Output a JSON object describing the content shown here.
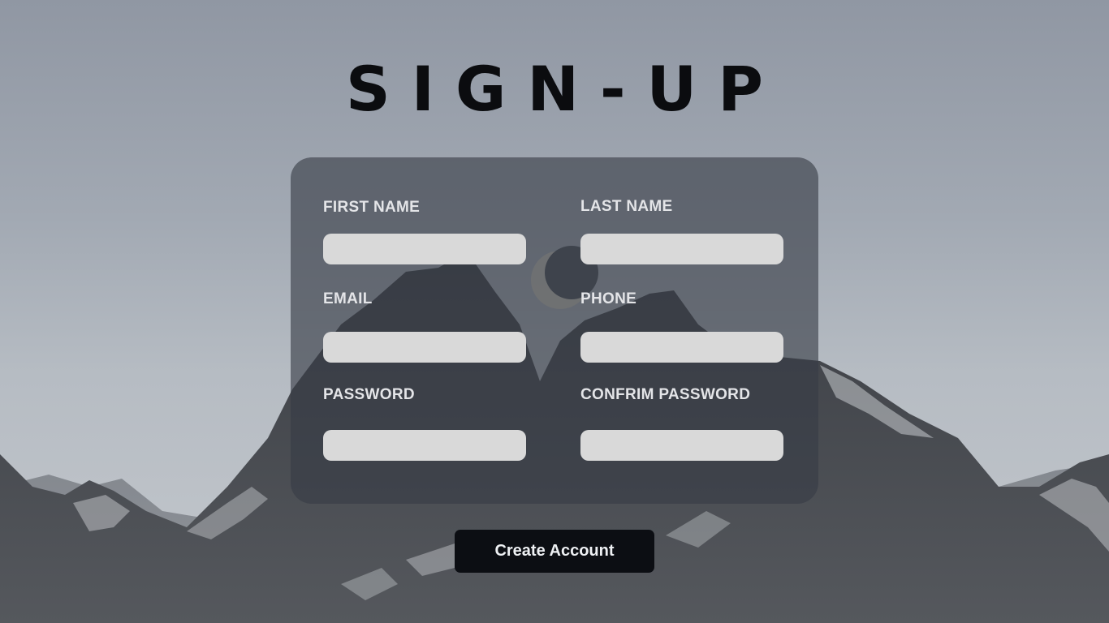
{
  "page": {
    "title": "SIGN-UP"
  },
  "form": {
    "first_name": {
      "label": "FIRST NAME",
      "value": ""
    },
    "last_name": {
      "label": "LAST NAME",
      "value": ""
    },
    "email": {
      "label": "EMAIL",
      "value": ""
    },
    "phone": {
      "label": "PHONE",
      "value": ""
    },
    "password": {
      "label": "PASSWORD",
      "value": ""
    },
    "confirm_password": {
      "label": "CONFRIM PASSWORD",
      "value": ""
    }
  },
  "actions": {
    "create_account_label": "Create Account"
  },
  "colors": {
    "title": "#0b0c0f",
    "card": "#373c46",
    "input": "#d9d9d9",
    "button": "#0c0e13",
    "label": "#e4e5e8"
  },
  "background": {
    "scene": "mountains-with-crescent-moon"
  }
}
